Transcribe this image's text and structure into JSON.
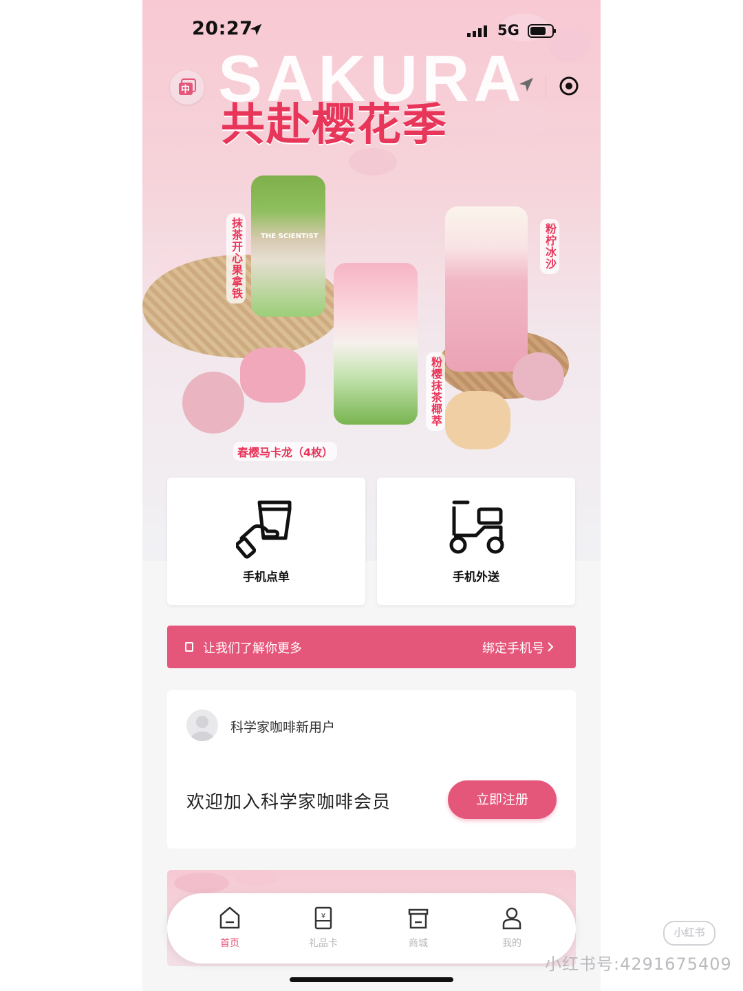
{
  "status_bar": {
    "time": "20:27",
    "network": "5G"
  },
  "header": {
    "lang_toggle": "中",
    "icons": [
      "location-arrow-icon",
      "target-icon"
    ]
  },
  "hero": {
    "title_en": "SAKURA",
    "title_cn": "共赴樱花季",
    "brand_text": "THE SCIENTIST",
    "products": [
      "抹茶开心果拿铁",
      "粉柠冰沙",
      "粉樱抹茶椰萃",
      "春樱马卡龙（4枚）"
    ]
  },
  "actions": {
    "order": {
      "label": "手机点单",
      "icon": "cup-in-hand-icon"
    },
    "delivery": {
      "label": "手机外送",
      "icon": "scooter-icon"
    }
  },
  "bind_bar": {
    "left_text": "让我们了解你更多",
    "right_text": "绑定手机号"
  },
  "member_card": {
    "user_name": "科学家咖啡新用户",
    "welcome": "欢迎加入科学家咖啡会员",
    "register_label": "立即注册"
  },
  "tabs": [
    {
      "label": "首页",
      "icon": "home-icon",
      "active": true
    },
    {
      "label": "礼品卡",
      "icon": "gift-card-icon",
      "active": false
    },
    {
      "label": "商城",
      "icon": "shop-icon",
      "active": false
    },
    {
      "label": "我的",
      "icon": "profile-icon",
      "active": false
    }
  ],
  "watermark": {
    "logo": "小红书",
    "text": "小红书号:4291675409"
  },
  "colors": {
    "accent": "#e5577a",
    "title_red": "#e8365a",
    "hero_pink": "#f8c9d3"
  }
}
